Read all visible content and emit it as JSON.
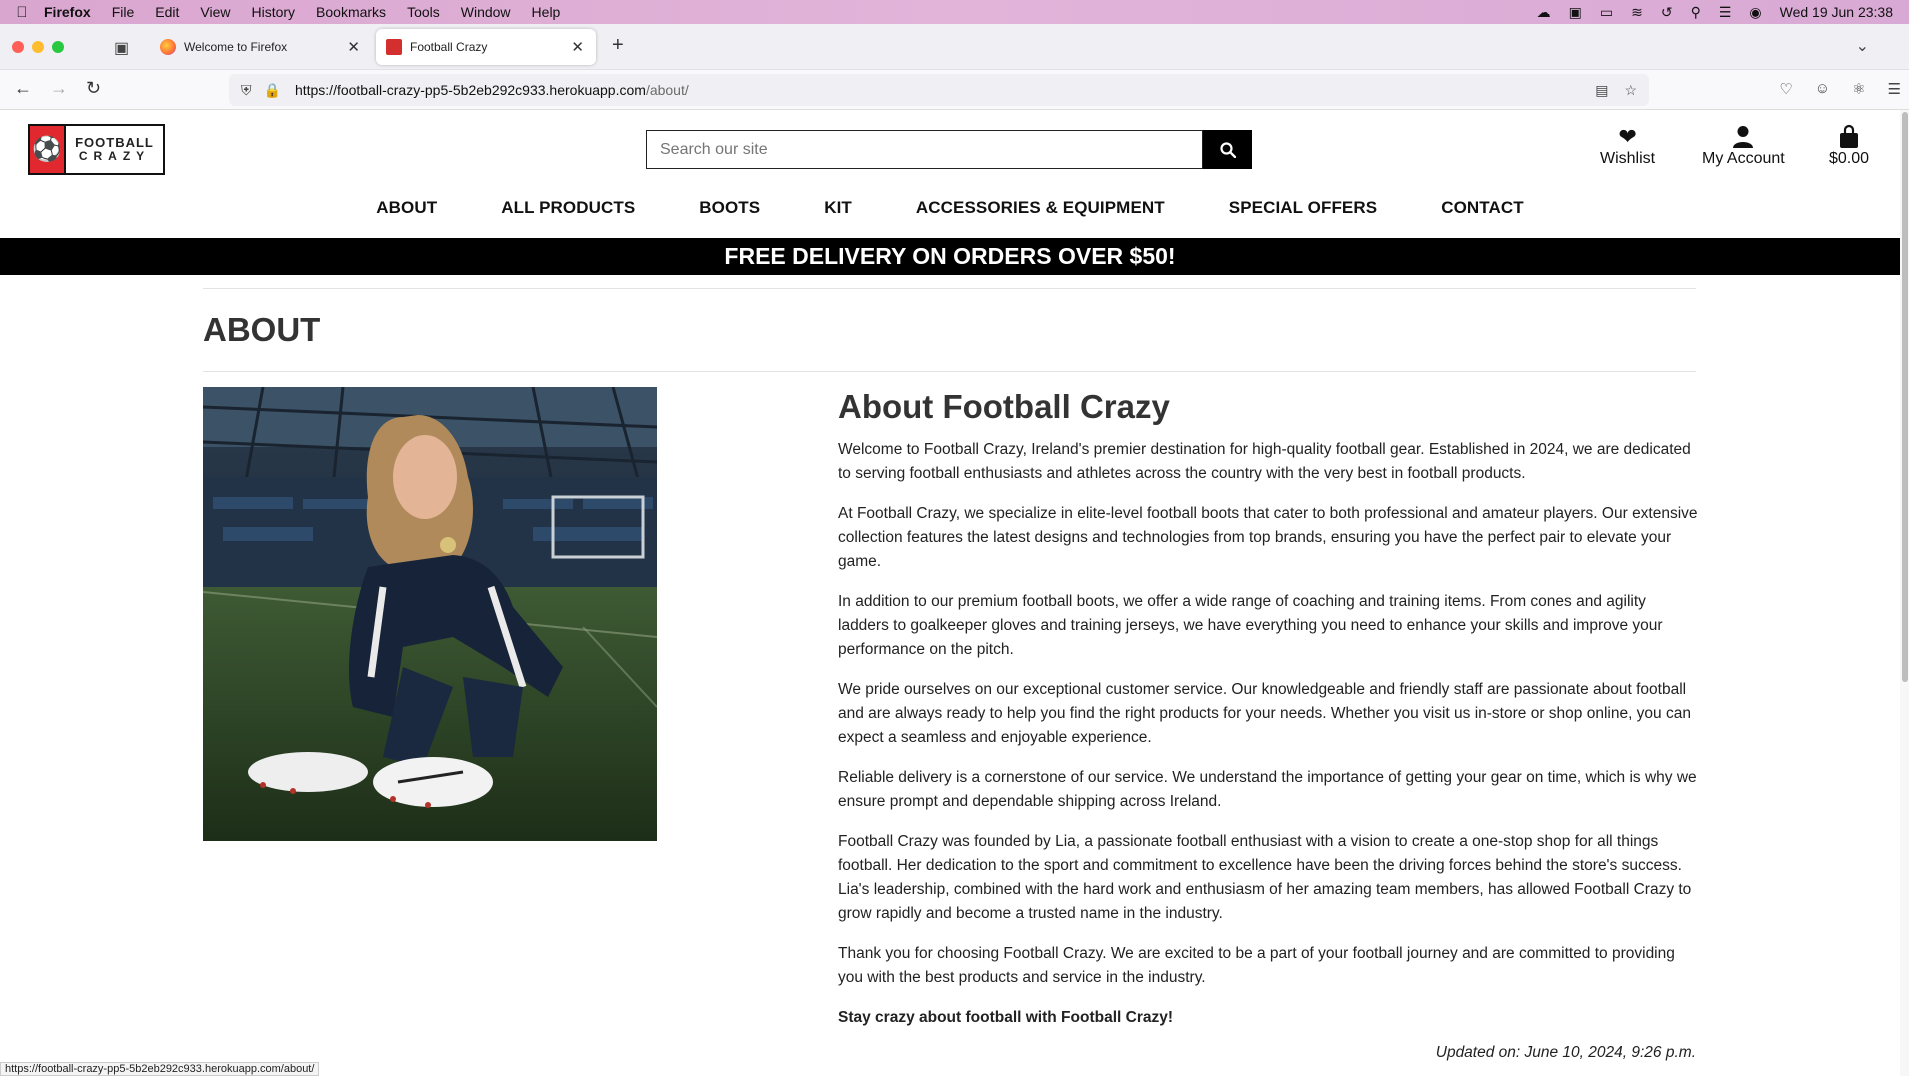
{
  "os_menubar": {
    "app": "Firefox",
    "menus": [
      "File",
      "Edit",
      "View",
      "History",
      "Bookmarks",
      "Tools",
      "Window",
      "Help"
    ],
    "clock": "Wed 19 Jun  23:38"
  },
  "browser": {
    "tabs": [
      {
        "title": "Welcome to Firefox",
        "active": false
      },
      {
        "title": "Football Crazy",
        "active": true
      }
    ],
    "url_host": "https://football-crazy-pp5-5b2eb292c933.herokuapp.com",
    "url_path": "/about/",
    "status_url": "https://football-crazy-pp5-5b2eb292c933.herokuapp.com/about/"
  },
  "site": {
    "logo": {
      "line1": "FOOTBALL",
      "line2": "CRAZY"
    },
    "search_placeholder": "Search our site",
    "wishlist_label": "Wishlist",
    "account_label": "My Account",
    "bag_total": "$0.00",
    "nav": [
      "ABOUT",
      "ALL PRODUCTS",
      "BOOTS",
      "KIT",
      "ACCESSORIES & EQUIPMENT",
      "SPECIAL OFFERS",
      "CONTACT"
    ],
    "banner": "FREE DELIVERY ON ORDERS OVER $50!"
  },
  "page": {
    "title": "ABOUT",
    "heading": "About Football Crazy",
    "paragraphs": [
      "Welcome to Football Crazy, Ireland's premier destination for high-quality football gear. Established in 2024, we are dedicated to serving football enthusiasts and athletes across the country with the very best in football products.",
      "At Football Crazy, we specialize in elite-level football boots that cater to both professional and amateur players. Our extensive collection features the latest designs and technologies from top brands, ensuring you have the perfect pair to elevate your game.",
      "In addition to our premium football boots, we offer a wide range of coaching and training items. From cones and agility ladders to goalkeeper gloves and training jerseys, we have everything you need to enhance your skills and improve your performance on the pitch.",
      "We pride ourselves on our exceptional customer service. Our knowledgeable and friendly staff are passionate about football and are always ready to help you find the right products for your needs. Whether you visit us in-store or shop online, you can expect a seamless and enjoyable experience.",
      "Reliable delivery is a cornerstone of our service. We understand the importance of getting your gear on time, which is why we ensure prompt and dependable shipping across Ireland.",
      "Football Crazy was founded by Lia, a passionate football enthusiast with a vision to create a one-stop shop for all things football. Her dedication to the sport and commitment to excellence have been the driving forces behind the store's success. Lia's leadership, combined with the hard work and enthusiasm of her amazing team members, has allowed Football Crazy to grow rapidly and become a trusted name in the industry.",
      "Thank you for choosing Football Crazy. We are excited to be a part of your football journey and are committed to providing you with the best products and service in the industry."
    ],
    "tagline": "Stay crazy about football with Football Crazy!",
    "updated": "Updated on: June 10, 2024, 9:26 p.m."
  },
  "colors": {
    "brand_red": "#e0282e",
    "banner_bg": "#000000",
    "menubar": "#e2b4da"
  },
  "icons": [
    "apple-icon",
    "search-icon",
    "heart-icon",
    "user-icon",
    "bag-icon",
    "shield-icon",
    "lock-icon",
    "reader-icon",
    "star-icon"
  ]
}
